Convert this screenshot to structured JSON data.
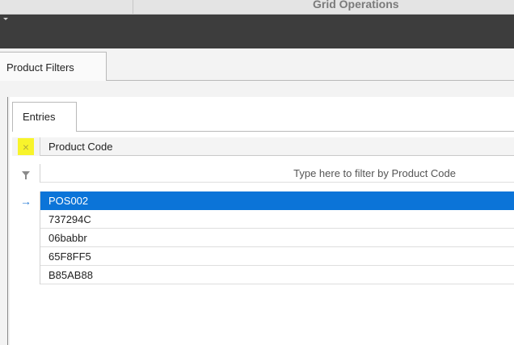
{
  "window": {
    "title": "Grid Operations"
  },
  "outer_tab": {
    "label": "Product  Filters"
  },
  "inner_tab": {
    "label": "Entries"
  },
  "grid": {
    "column_header": "Product Code",
    "filter_placeholder": "Type here to filter by Product Code",
    "rows": [
      "POS002",
      "737294C",
      "06babbr",
      "65F8FF5",
      "B85AB88"
    ],
    "selected_row": "POS002"
  },
  "colors": {
    "selection": "#0b74d8",
    "highlight": "#f8f42b",
    "dark_bar": "#3d3d3d"
  },
  "icons": [
    "clear-icon",
    "filter-icon",
    "current-row-arrow-icon",
    "collapse-caret-icon"
  ]
}
